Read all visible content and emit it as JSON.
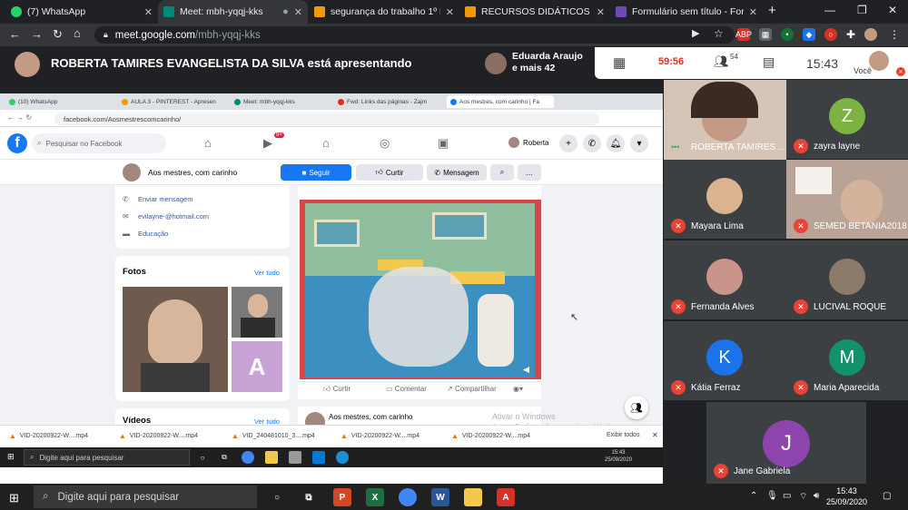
{
  "browser": {
    "tabs": [
      {
        "label": "(7) WhatsApp",
        "color": "#25d366"
      },
      {
        "label": "Meet: mbh-yqqj-kks",
        "color": "#00897b"
      },
      {
        "label": "segurança do trabalho 1º PERÍ",
        "color": "#f29900"
      },
      {
        "label": "RECURSOS DIDÁTICOS",
        "color": "#f29900"
      },
      {
        "label": "Formulário sem título - Formu",
        "color": "#7248b9"
      }
    ],
    "url_host": "meet.google.com",
    "url_path": "/mbh-yqqj-kks"
  },
  "meet": {
    "presenting_text": "ROBERTA TAMIRES EVANGELISTA DA SILVA está apresentando",
    "people_line1": "Eduarda Araujo",
    "people_line2": "e mais 42",
    "timer": "59:56",
    "participant_count": "54",
    "clock": "15:43",
    "you_label": "Você"
  },
  "shared": {
    "tabs": [
      "(10) WhatsApp",
      "AULA 3 - PINTEREST - Apresen",
      "Meet: mbh-yqqj-kks",
      "Fwd: Links das páginas - Zajm",
      "Aos mestres, com carinho | Fa"
    ],
    "url": "facebook.com/Aosmestrescomcarinho/",
    "fb": {
      "search_placeholder": "Pesquisar no Facebook",
      "notif_badge": "9+",
      "user": "Roberta",
      "page_name": "Aos mestres, com carinho",
      "btn_follow": "Seguir",
      "btn_like": "Curtir",
      "btn_message": "Mensagem",
      "info_message": "Enviar mensagem",
      "info_email": "evilayne-@hotmail.com",
      "info_category": "Educação",
      "photos_title": "Fotos",
      "see_all": "Ver tudo",
      "photo_letter": "A",
      "videos_title": "Vídeos",
      "act_like": "Curtir",
      "act_comment": "Comentar",
      "act_share": "Compartilhar",
      "post2_name": "Aos mestres, com carinho",
      "watermark1": "Ativar o Windows",
      "watermark2": "Acesse Configurações para ativar o Windows."
    },
    "downloads": [
      "VID-20200922-W....mp4",
      "VID-20200922-W....mp4",
      "VID_240481010_3....mp4",
      "VID-20200922-W....mp4",
      "VID-20200922-W....mp4"
    ],
    "show_all": "Exibir todos",
    "taskbar_search": "Digite aqui para pesquisar",
    "taskbar_time": "15:43",
    "taskbar_date": "25/09/2020"
  },
  "participants": [
    {
      "name": "ROBERTA TAMIRES ...",
      "initial": "",
      "color": "#d4b8a8",
      "muted": false
    },
    {
      "name": "zayra layne",
      "initial": "Z",
      "color": "#7cb342",
      "muted": true
    },
    {
      "name": "Mayara Lima",
      "initial": "",
      "color": "#d9b48f",
      "muted": true
    },
    {
      "name": "SEMED BETANIA2018",
      "initial": "",
      "color": "#a58b7a",
      "muted": true
    },
    {
      "name": "Fernanda Alves",
      "initial": "",
      "color": "#c9958a",
      "muted": true
    },
    {
      "name": "LUCIVAL ROQUE",
      "initial": "",
      "color": "#8c7a6b",
      "muted": true
    },
    {
      "name": "Kátia Ferraz",
      "initial": "K",
      "color": "#1a73e8",
      "muted": true
    },
    {
      "name": "Maria Aparecida",
      "initial": "M",
      "color": "#12926b",
      "muted": true
    },
    {
      "name": "Jane Gabriela",
      "initial": "J",
      "color": "#8e44ad",
      "muted": true
    }
  ],
  "taskbar": {
    "search": "Digite aqui para pesquisar",
    "time": "15:43",
    "date": "25/09/2020"
  }
}
